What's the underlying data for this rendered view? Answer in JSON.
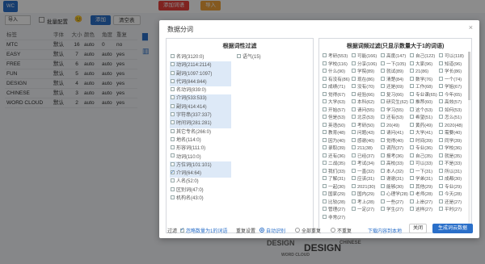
{
  "topbar": {
    "logo_text": "WC",
    "btn_add": "添加词语",
    "btn_import": "导入"
  },
  "toolbar": {
    "select_value": "导入",
    "checkbox_label": "批量配置",
    "emoji": "😊",
    "btn_blue": "添加",
    "btn_clear": "清空表"
  },
  "word_table": {
    "headers": [
      "标签",
      "字体",
      "大小",
      "颜色",
      "角度",
      "重复"
    ],
    "rows": [
      [
        "MTC",
        "默认",
        "16",
        "auto",
        "0",
        "no"
      ],
      [
        "EASY",
        "默认",
        "7",
        "auto",
        "auto",
        "yes"
      ],
      [
        "FREE",
        "默认",
        "6",
        "auto",
        "auto",
        "yes"
      ],
      [
        "FUN",
        "默认",
        "5",
        "auto",
        "auto",
        "yes"
      ],
      [
        "DESIGN",
        "默认",
        "4",
        "auto",
        "auto",
        "yes"
      ],
      [
        "CHINESE",
        "默认",
        "3",
        "auto",
        "auto",
        "yes"
      ],
      [
        "WORD CLOUD",
        "默认",
        "2",
        "auto",
        "auto",
        "yes"
      ]
    ]
  },
  "art_words": [
    "DESIGN",
    "DESIGN",
    "CHINESE",
    "WORD CLOUD"
  ],
  "modal": {
    "title": "数据分词",
    "close_icon": "×",
    "left_panel": {
      "title": "根据词性过滤",
      "col1": [
        {
          "label": "名词(3120:0)",
          "selected": false,
          "checked": false
        },
        {
          "label": "动词(2114:2114)",
          "selected": true,
          "checked": false
        },
        {
          "label": "副词(1097:1097)",
          "selected": true,
          "checked": false
        },
        {
          "label": "代词(844:844)",
          "selected": true,
          "checked": false
        },
        {
          "label": "名动词(839:0)",
          "selected": false,
          "checked": false
        },
        {
          "label": "介词(533:533)",
          "selected": true,
          "checked": false
        },
        {
          "label": "副词(414:414)",
          "selected": true,
          "checked": false
        },
        {
          "label": "字符串(337:337)",
          "selected": true,
          "checked": false
        },
        {
          "label": "时间词(281:281)",
          "selected": true,
          "checked": false
        },
        {
          "label": "其它专名(266:0)",
          "selected": false,
          "checked": false
        },
        {
          "label": "地名(114:0)",
          "selected": false,
          "checked": false
        },
        {
          "label": "形容词(111:0)",
          "selected": false,
          "checked": false
        },
        {
          "label": "动词(110:0)",
          "selected": false,
          "checked": false
        },
        {
          "label": "方位词(101:101)",
          "selected": true,
          "checked": false
        },
        {
          "label": "介词(64:64)",
          "selected": true,
          "checked": true
        },
        {
          "label": "人名(52:0)",
          "selected": false,
          "checked": false
        },
        {
          "label": "区别词(47:0)",
          "selected": false,
          "checked": false
        },
        {
          "label": "机构名(43:0)",
          "selected": false,
          "checked": false
        }
      ],
      "col2": [
        {
          "label": "语气(15)",
          "selected": false,
          "checked": false
        }
      ]
    },
    "right_panel": {
      "title": "根据词频过滤(只显示数量大于1的词语)",
      "cells": [
        "考研(553)",
        "可能(166)",
        "高度(147)",
        "自己(122)",
        "可以(118)",
        "学校(116)",
        "分享(106)",
        "一下(105)",
        "大家(96)",
        "知道(96)",
        "什么(90)",
        "学院(89)",
        "就试(89)",
        "21(86)",
        "学长(86)",
        "有没有(86)",
        "现在(86)",
        "清楚(84)",
        "数学(76)",
        "一个(74)",
        "成绩(71)",
        "没有(70)",
        "还是(69)",
        "工作(68)",
        "学姐(67)",
        "觉得(67)",
        "经验(66)",
        "复习(66)",
        "专业课(65)",
        "今年(65)",
        "大学(63)",
        "本科(62)",
        "研究生(62)",
        "推荐(60)",
        "高效(57)",
        "开始(57)",
        "请问(55)",
        "学习(55)",
        "这个(53)",
        "如何(53)",
        "但是(53)",
        "北京(53)",
        "还有(53)",
        "希望(51)",
        "怎么(51)",
        "英语(50)",
        "考研(50)",
        "20(49)",
        "黄药(49)",
        "2020(48)",
        "教育(48)",
        "问题(43)",
        "请问(41)",
        "大学(41)",
        "需要(40)",
        "因为(40)",
        "感谢(40)",
        "觉得(40)",
        "时间(39)",
        "同学(39)",
        "录取(39)",
        "211(38)",
        "调剂(37)",
        "专业(36)",
        "学校(36)",
        "还有(36)",
        "已经(37)",
        "报考(36)",
        "自己(35)",
        "就是(35)",
        "二战(35)",
        "考试(34)",
        "高校(33)",
        "可以(33)",
        "不是(33)",
        "我们(33)",
        "一直(32)",
        "本人(32)",
        "一下(31)",
        "所以(31)",
        "了解(31)",
        "应该(31)",
        "谢谢(31)",
        "学弟(31)",
        "成都(30)",
        "一起(30)",
        "2021(30)",
        "能够(30)",
        "其他(29)",
        "专业(29)",
        "国家(29)",
        "国内(29)",
        "心理学(28)",
        "老师(28)",
        "今天(28)",
        "比较(28)",
        "考上(28)",
        "一些(27)",
        "上岸(27)",
        "还是(27)",
        "管理(27)",
        "一定(27)",
        "学生(27)",
        "这样(27)",
        "平时(27)",
        "非常(27)"
      ]
    },
    "footer": {
      "filter_label": "过滤",
      "filter_check_label": "忽略数量为1的词语",
      "repeat_label": "重复设置",
      "radio_auto": "自动识别",
      "radio_all": "全部重复",
      "radio_none": "不重复",
      "link_download": "下载内容到本地",
      "btn_close": "关闭",
      "btn_generate": "生成词云数据"
    }
  },
  "colors": {
    "accent": "#2a6fc9",
    "selected_row": "#dde9f7",
    "red_button": "#e8413b",
    "orange_button": "#f0a33a"
  }
}
